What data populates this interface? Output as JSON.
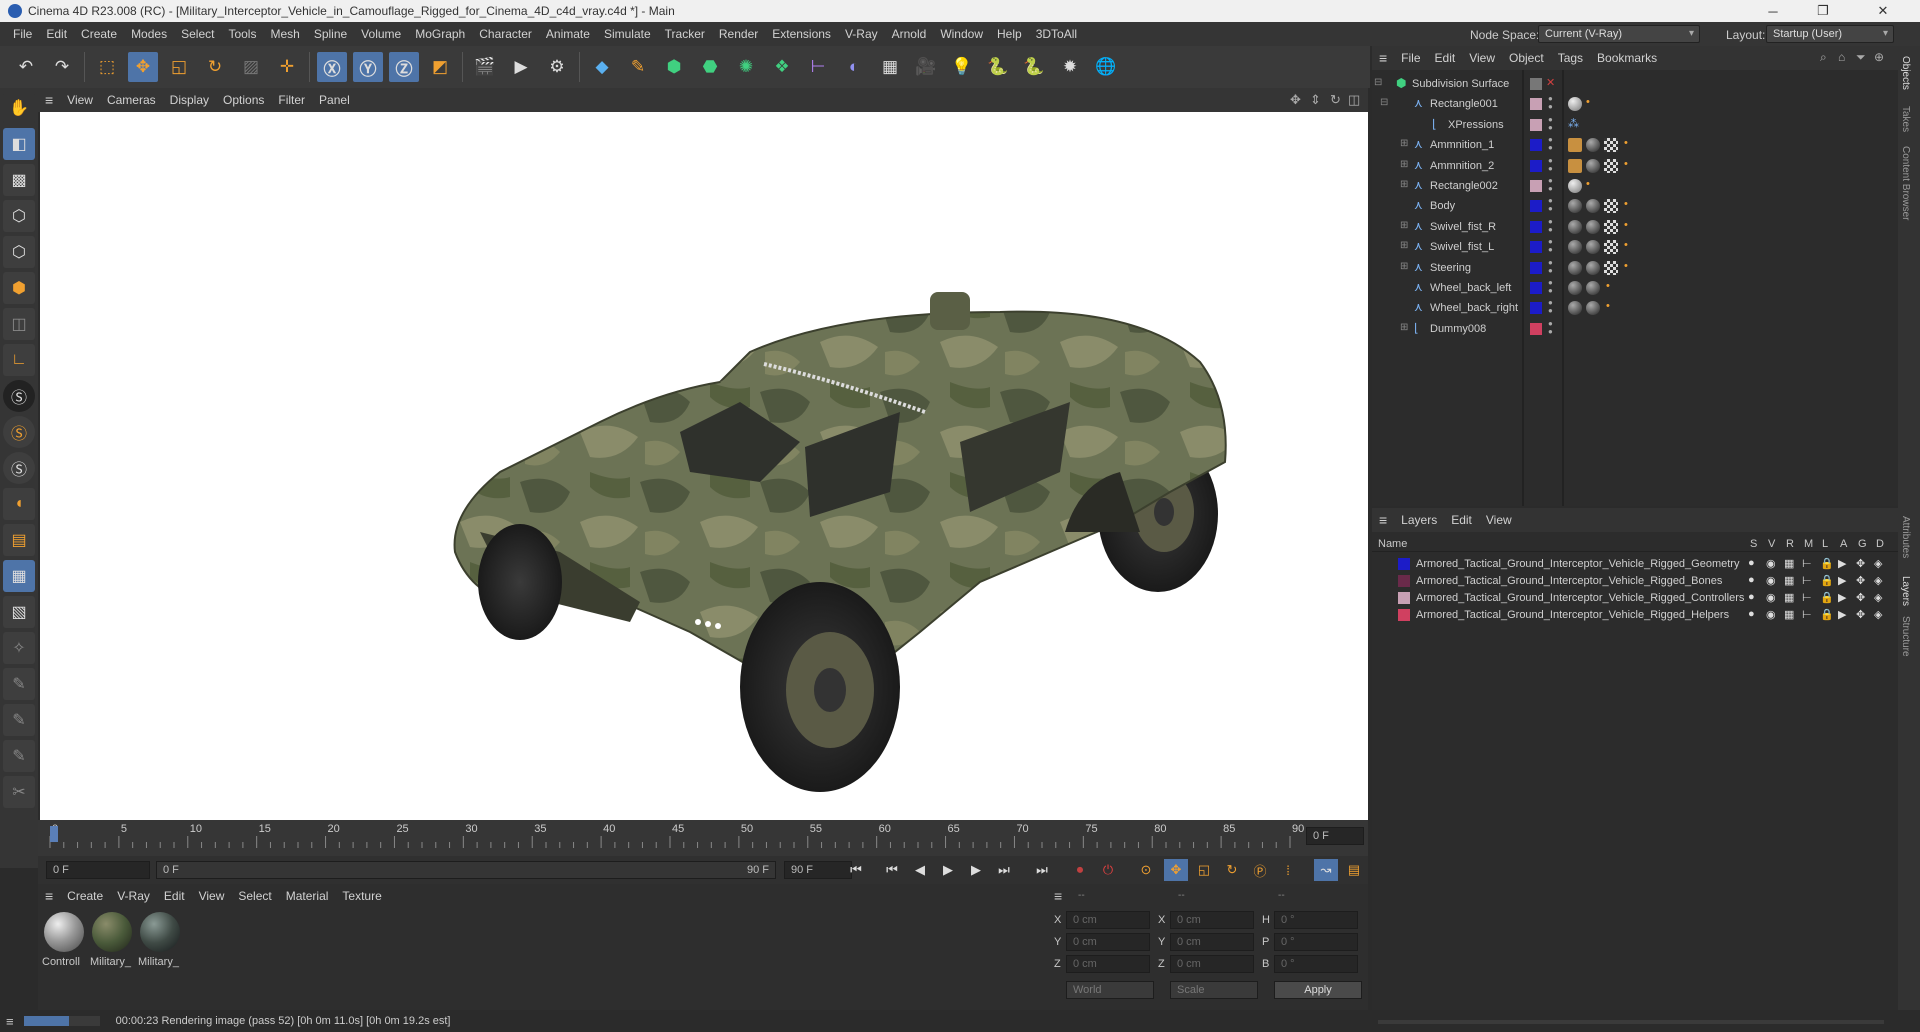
{
  "window": {
    "title": "Cinema 4D R23.008 (RC) - [Military_Interceptor_Vehicle_in_Camouflage_Rigged_for_Cinema_4D_c4d_vray.c4d *] - Main",
    "minimize": "─",
    "maximize": "❐",
    "close": "✕"
  },
  "menu": [
    "File",
    "Edit",
    "Create",
    "Modes",
    "Select",
    "Tools",
    "Mesh",
    "Spline",
    "Volume",
    "MoGraph",
    "Character",
    "Animate",
    "Simulate",
    "Tracker",
    "Render",
    "Extensions",
    "V-Ray",
    "Arnold",
    "Window",
    "Help",
    "3DToAll"
  ],
  "node_space": {
    "label": "Node Space:",
    "value": "Current (V-Ray)"
  },
  "layout": {
    "label": "Layout:",
    "value": "Startup (User)"
  },
  "viewport_menu": [
    "View",
    "Cameras",
    "Display",
    "Options",
    "Filter",
    "Panel"
  ],
  "timeline": {
    "ticks": [
      "0",
      "5",
      "10",
      "15",
      "20",
      "25",
      "30",
      "35",
      "40",
      "45",
      "50",
      "55",
      "60",
      "65",
      "70",
      "75",
      "80",
      "85",
      "90"
    ],
    "current_frame": "0 F",
    "start_field": "0 F",
    "range_start": "0 F",
    "range_end": "90 F",
    "end_field": "90 F"
  },
  "material_menu": [
    "Create",
    "V-Ray",
    "Edit",
    "View",
    "Select",
    "Material",
    "Texture"
  ],
  "materials": [
    {
      "name": "Controll",
      "color": "#9a9a9a"
    },
    {
      "name": "Military_",
      "color": "#4a5a3a"
    },
    {
      "name": "Military_",
      "color": "#3f4a45"
    }
  ],
  "coords": {
    "header": [
      "--",
      "--",
      "--"
    ],
    "rows": [
      {
        "a": "X",
        "av": "0 cm",
        "b": "X",
        "bv": "0 cm",
        "c": "H",
        "cv": "0 °"
      },
      {
        "a": "Y",
        "av": "0 cm",
        "b": "Y",
        "bv": "0 cm",
        "c": "P",
        "cv": "0 °"
      },
      {
        "a": "Z",
        "av": "0 cm",
        "b": "Z",
        "bv": "0 cm",
        "c": "B",
        "cv": "0 °"
      }
    ],
    "world": "World",
    "scale": "Scale",
    "apply": "Apply"
  },
  "status": "00:00:23 Rendering image (pass 52) [0h  0m 11.0s] [0h  0m 19.2s est]",
  "object_menu": [
    "File",
    "Edit",
    "View",
    "Object",
    "Tags",
    "Bookmarks"
  ],
  "objects": [
    {
      "name": "Subdivision Surface",
      "color": "",
      "tags": ""
    },
    {
      "name": "Rectangle001",
      "color": "#c8a0b4",
      "tags": "sphere"
    },
    {
      "name": "XPressions",
      "color": "#c8a0b4",
      "tags": "xp"
    },
    {
      "name": "Ammnition_1",
      "color": "#1c1cc8",
      "tags": "full"
    },
    {
      "name": "Ammnition_2",
      "color": "#1c1cc8",
      "tags": "full"
    },
    {
      "name": "Rectangle002",
      "color": "#c8a0b4",
      "tags": "sphere"
    },
    {
      "name": "Body",
      "color": "#1c1cc8",
      "tags": "full"
    },
    {
      "name": "Swivel_fist_R",
      "color": "#1c1cc8",
      "tags": "full"
    },
    {
      "name": "Swivel_fist_L",
      "color": "#1c1cc8",
      "tags": "full"
    },
    {
      "name": "Steering",
      "color": "#1c1cc8",
      "tags": "full"
    },
    {
      "name": "Wheel_back_left",
      "color": "#1c1cc8",
      "tags": "two"
    },
    {
      "name": "Wheel_back_right",
      "color": "#1c1cc8",
      "tags": "two"
    },
    {
      "name": "Dummy008",
      "color": "#d04060",
      "tags": ""
    }
  ],
  "layers_menu": [
    "Layers",
    "Edit",
    "View"
  ],
  "layers_header": {
    "name": "Name",
    "cols": [
      "S",
      "V",
      "R",
      "M",
      "L",
      "A",
      "G",
      "D"
    ]
  },
  "layers": [
    {
      "name": "Armored_Tactical_Ground_Interceptor_Vehicle_Rigged_Geometry",
      "color": "#1c1cc8"
    },
    {
      "name": "Armored_Tactical_Ground_Interceptor_Vehicle_Rigged_Bones",
      "color": "#6a2a4a"
    },
    {
      "name": "Armored_Tactical_Ground_Interceptor_Vehicle_Rigged_Controllers",
      "color": "#c8a0b4"
    },
    {
      "name": "Armored_Tactical_Ground_Interceptor_Vehicle_Rigged_Helpers",
      "color": "#d04060"
    }
  ],
  "side_tabs": [
    "Objects",
    "Takes",
    "Content Browser",
    "Attributes",
    "Layers",
    "Structure"
  ]
}
